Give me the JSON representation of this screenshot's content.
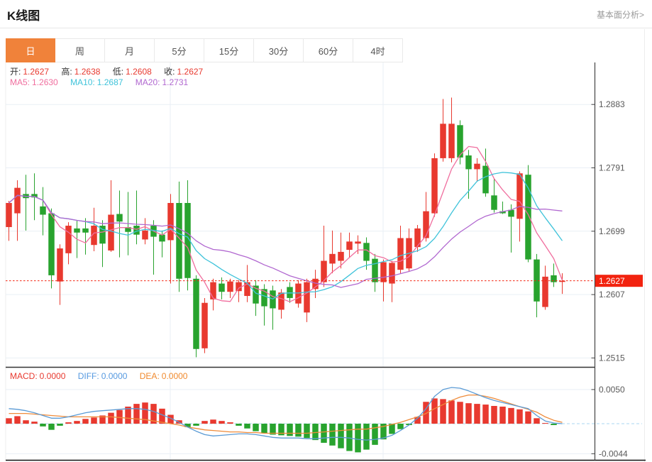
{
  "header": {
    "title": "K线图",
    "link": "基本面分析>"
  },
  "tabs": {
    "items": [
      "日",
      "周",
      "月",
      "5分",
      "15分",
      "30分",
      "60分",
      "4时"
    ],
    "active_index": 0
  },
  "ohlc_info": {
    "open_label": "开:",
    "open": "1.2627",
    "high_label": "高:",
    "high": "1.2638",
    "low_label": "低:",
    "low": "1.2608",
    "close_label": "收:",
    "close": "1.2627"
  },
  "ma_info": {
    "ma5_label": "MA5:",
    "ma5": "1.2630",
    "ma10_label": "MA10:",
    "ma10": "1.2687",
    "ma20_label": "MA20:",
    "ma20": "1.2731"
  },
  "macd_info": {
    "macd_label": "MACD:",
    "macd": "0.0000",
    "diff_label": "DIFF:",
    "diff": "0.0000",
    "dea_label": "DEA:",
    "dea": "0.0000"
  },
  "colors": {
    "up": "#e8392f",
    "down": "#28a32e",
    "ma5": "#f06e9e",
    "ma10": "#3fc3da",
    "ma20": "#b168d0",
    "diff_line": "#5b9bd5",
    "dea_line": "#ef8b3a",
    "active_tab": "#f0823a",
    "current_price": "#f2230f",
    "grid": "#e9eff5",
    "axis": "#444444",
    "tick_label": "#595959",
    "zero_dash": "#a9d7f0",
    "divider": "#333333"
  },
  "chart_data": {
    "main": {
      "type": "candlestick",
      "title": "K线图",
      "ylabel": "price",
      "ylim": [
        1.2502,
        1.2944
      ],
      "y_ticks": [
        1.2883,
        1.2791,
        1.2699,
        1.2607,
        1.2515
      ],
      "current_price": 1.2627,
      "last_candle": {
        "open": 1.2627,
        "high": 1.2638,
        "low": 1.2608,
        "close": 1.2627
      },
      "ma_periods": [
        5,
        10,
        20
      ],
      "ma_values": {
        "ma5": 1.263,
        "ma10": 1.2687,
        "ma20": 1.2731
      },
      "grid": true,
      "legend_position": "top-left",
      "candles_ohlc": [
        [
          1.2705,
          1.2743,
          1.2685,
          1.274
        ],
        [
          1.2725,
          1.2773,
          1.2685,
          1.2762
        ],
        [
          1.2753,
          1.2781,
          1.27,
          1.2747
        ],
        [
          1.2753,
          1.2783,
          1.2715,
          1.2748
        ],
        [
          1.2735,
          1.2763,
          1.2693,
          1.2723
        ],
        [
          1.2725,
          1.2732,
          1.2616,
          1.2635
        ],
        [
          1.2626,
          1.268,
          1.2592,
          1.2674
        ],
        [
          1.2667,
          1.2712,
          1.2651,
          1.2707
        ],
        [
          1.2703,
          1.2715,
          1.266,
          1.2697
        ],
        [
          1.2703,
          1.2718,
          1.2665,
          1.2697
        ],
        [
          1.2679,
          1.2733,
          1.267,
          1.2707
        ],
        [
          1.2707,
          1.2715,
          1.2647,
          1.2681
        ],
        [
          1.2671,
          1.2773,
          1.2669,
          1.2723
        ],
        [
          1.2724,
          1.2758,
          1.2661,
          1.2713
        ],
        [
          1.2705,
          1.2756,
          1.2664,
          1.2698
        ],
        [
          1.2707,
          1.2758,
          1.268,
          1.2694
        ],
        [
          1.2687,
          1.2718,
          1.268,
          1.27
        ],
        [
          1.2707,
          1.2715,
          1.2636,
          1.2691
        ],
        [
          1.2694,
          1.27,
          1.2661,
          1.2684
        ],
        [
          1.2686,
          1.2753,
          1.2623,
          1.274
        ],
        [
          1.274,
          1.2771,
          1.2611,
          1.263
        ],
        [
          1.274,
          1.2773,
          1.2613,
          1.2631
        ],
        [
          1.263,
          1.2635,
          1.2516,
          1.2528
        ],
        [
          1.2529,
          1.2602,
          1.2522,
          1.2595
        ],
        [
          1.26,
          1.263,
          1.2584,
          1.2625
        ],
        [
          1.2623,
          1.2632,
          1.26,
          1.2611
        ],
        [
          1.2611,
          1.263,
          1.2602,
          1.2626
        ],
        [
          1.2612,
          1.2628,
          1.2596,
          1.2625
        ],
        [
          1.2605,
          1.265,
          1.2596,
          1.2625
        ],
        [
          1.262,
          1.2628,
          1.2576,
          1.2594
        ],
        [
          1.2615,
          1.2622,
          1.2562,
          1.259
        ],
        [
          1.2613,
          1.262,
          1.2556,
          1.2587
        ],
        [
          1.2585,
          1.2615,
          1.2572,
          1.261
        ],
        [
          1.2618,
          1.2625,
          1.2595,
          1.2602
        ],
        [
          1.2594,
          1.2628,
          1.2588,
          1.2623
        ],
        [
          1.2581,
          1.263,
          1.2567,
          1.2625
        ],
        [
          1.2615,
          1.2643,
          1.2602,
          1.263
        ],
        [
          1.2625,
          1.2707,
          1.2618,
          1.2656
        ],
        [
          1.2652,
          1.27,
          1.2638,
          1.2666
        ],
        [
          1.2656,
          1.2697,
          1.2645,
          1.2669
        ],
        [
          1.2672,
          1.2697,
          1.266,
          1.2684
        ],
        [
          1.2681,
          1.2693,
          1.2666,
          1.2684
        ],
        [
          1.2682,
          1.269,
          1.2643,
          1.2656
        ],
        [
          1.2659,
          1.2666,
          1.2611,
          1.2625
        ],
        [
          1.2625,
          1.2658,
          1.2597,
          1.2654
        ],
        [
          1.2623,
          1.2656,
          1.2596,
          1.2653
        ],
        [
          1.2643,
          1.2707,
          1.2638,
          1.2689
        ],
        [
          1.2645,
          1.2703,
          1.264,
          1.2689
        ],
        [
          1.2676,
          1.2708,
          1.2669,
          1.2703
        ],
        [
          1.2689,
          1.2756,
          1.2684,
          1.2728
        ],
        [
          1.2725,
          1.2812,
          1.272,
          1.2805
        ],
        [
          1.2805,
          1.2891,
          1.28,
          1.2855
        ],
        [
          1.2805,
          1.2893,
          1.2799,
          1.2855
        ],
        [
          1.2853,
          1.286,
          1.2796,
          1.2806
        ],
        [
          1.2809,
          1.2817,
          1.2746,
          1.2789
        ],
        [
          1.2789,
          1.2805,
          1.2772,
          1.2797
        ],
        [
          1.2794,
          1.2819,
          1.2749,
          1.2754
        ],
        [
          1.2751,
          1.2776,
          1.2726,
          1.273
        ],
        [
          1.2728,
          1.2742,
          1.2724,
          1.2725
        ],
        [
          1.273,
          1.2738,
          1.2668,
          1.272
        ],
        [
          1.2717,
          1.2786,
          1.2684,
          1.2783
        ],
        [
          1.2781,
          1.2795,
          1.2654,
          1.2658
        ],
        [
          1.2658,
          1.2666,
          1.2574,
          1.2597
        ],
        [
          1.2589,
          1.2649,
          1.2585,
          1.2633
        ],
        [
          1.2635,
          1.2652,
          1.2618,
          1.2625
        ],
        [
          1.2627,
          1.2638,
          1.2608,
          1.2627
        ]
      ]
    },
    "macd": {
      "type": "bar",
      "title": "MACD",
      "ylim": [
        -0.0053,
        0.0079
      ],
      "y_ticks": [
        0.005,
        -0.0044
      ],
      "values": {
        "macd": 0.0,
        "diff": 0.0,
        "dea": 0.0
      },
      "histogram": [
        0.0008,
        0.0011,
        0.0005,
        0.0003,
        -0.0004,
        -0.0009,
        -0.0003,
        0.0002,
        0.0004,
        0.0007,
        0.0009,
        0.0012,
        0.0016,
        0.002,
        0.0025,
        0.0029,
        0.0031,
        0.0029,
        0.0022,
        0.0013,
        0.0005,
        -0.0005,
        -0.0003,
        0.0004,
        0.0006,
        0.0004,
        0.0002,
        -0.0003,
        -0.0007,
        -0.0011,
        -0.0014,
        -0.0016,
        -0.0017,
        -0.0018,
        -0.0019,
        -0.0021,
        -0.0024,
        -0.0028,
        -0.0032,
        -0.0036,
        -0.004,
        -0.0042,
        -0.0038,
        -0.0031,
        -0.0023,
        -0.0015,
        -0.0008,
        -0.0002,
        0.001,
        0.0032,
        0.0037,
        0.0036,
        0.0034,
        0.0032,
        0.003,
        0.0029,
        0.0028,
        0.0026,
        0.0025,
        0.0023,
        0.0021,
        0.0018,
        0.0008,
        0.0001,
        -0.0002,
        0.0
      ],
      "diff": [
        0.0022,
        0.0021,
        0.0019,
        0.0016,
        0.0012,
        0.0008,
        0.0008,
        0.001,
        0.0013,
        0.0016,
        0.0018,
        0.0019,
        0.002,
        0.0021,
        0.0022,
        0.0022,
        0.0021,
        0.0018,
        0.0013,
        0.0008,
        0.0002,
        -0.0005,
        -0.0011,
        -0.0016,
        -0.0018,
        -0.0017,
        -0.0016,
        -0.0015,
        -0.0015,
        -0.0016,
        -0.0018,
        -0.002,
        -0.0021,
        -0.0021,
        -0.0021,
        -0.0022,
        -0.0022,
        -0.0021,
        -0.002,
        -0.002,
        -0.0021,
        -0.0023,
        -0.0024,
        -0.0023,
        -0.0021,
        -0.0017,
        -0.001,
        -0.0002,
        0.0008,
        0.0022,
        0.004,
        0.005,
        0.0053,
        0.0052,
        0.0048,
        0.0043,
        0.0038,
        0.0034,
        0.0031,
        0.0028,
        0.0025,
        0.0022,
        0.0012,
        0.0004,
        0.0001,
        0.0
      ],
      "dea": [
        0.0015,
        0.0015,
        0.0015,
        0.0014,
        0.0013,
        0.0012,
        0.0011,
        0.001,
        0.001,
        0.001,
        0.001,
        0.001,
        0.001,
        0.0009,
        0.0008,
        0.0007,
        0.0006,
        0.0004,
        0.0002,
        0.0,
        -0.0002,
        -0.0005,
        -0.0007,
        -0.0009,
        -0.001,
        -0.0011,
        -0.0012,
        -0.0012,
        -0.0013,
        -0.0013,
        -0.0014,
        -0.0014,
        -0.0014,
        -0.0014,
        -0.0014,
        -0.0014,
        -0.0013,
        -0.0012,
        -0.0011,
        -0.001,
        -0.0009,
        -0.0008,
        -0.0008,
        -0.0006,
        -0.0004,
        -0.0001,
        0.0002,
        0.0006,
        0.001,
        0.0015,
        0.0022,
        0.0028,
        0.0034,
        0.0039,
        0.0042,
        0.0042,
        0.004,
        0.0037,
        0.0033,
        0.0029,
        0.0025,
        0.0021,
        0.0017,
        0.001,
        0.0005,
        0.0002
      ]
    }
  }
}
